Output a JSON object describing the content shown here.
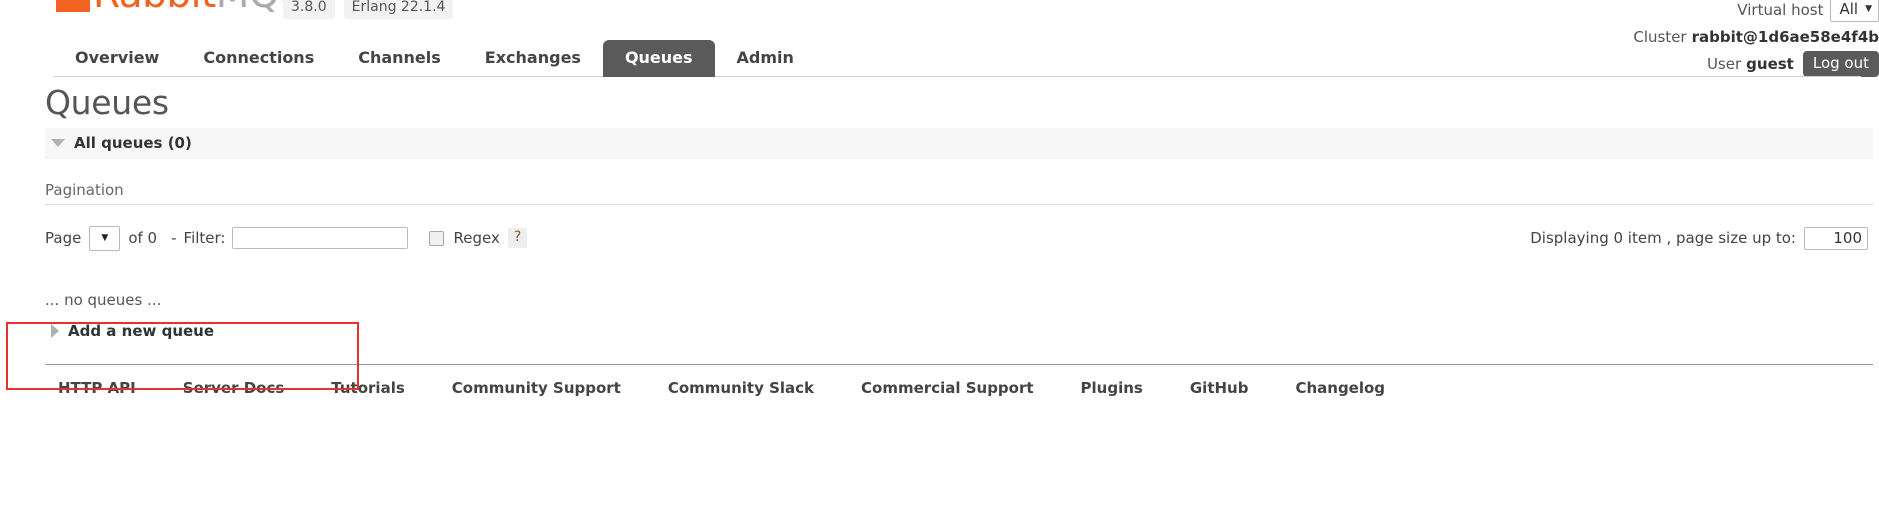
{
  "header": {
    "logo": {
      "brand_first": "Rabbit",
      "brand_second": "MQ",
      "trademark": "™"
    },
    "version_badge": "3.8.0",
    "erlang_badge": "Erlang 22.1.4",
    "virtual_host_label": "Virtual host",
    "virtual_host_value": "All",
    "cluster_label": "Cluster",
    "cluster_value": "rabbit@1d6ae58e4f4b",
    "user_label": "User",
    "user_value": "guest",
    "logout_label": "Log out"
  },
  "nav": {
    "tabs": [
      {
        "label": "Overview",
        "selected": false
      },
      {
        "label": "Connections",
        "selected": false
      },
      {
        "label": "Channels",
        "selected": false
      },
      {
        "label": "Exchanges",
        "selected": false
      },
      {
        "label": "Queues",
        "selected": true
      },
      {
        "label": "Admin",
        "selected": false
      }
    ]
  },
  "main": {
    "page_title": "Queues",
    "all_queues_label": "All queues (0)",
    "pagination": {
      "section_title": "Pagination",
      "page_label": "Page",
      "page_value": "",
      "of_label": "of 0",
      "separator": "-",
      "filter_label": "Filter:",
      "filter_value": "",
      "filter_placeholder": "",
      "regex_label": "Regex",
      "regex_checked": false,
      "help_label": "?",
      "displaying_text": "Displaying 0 item , page size up to:",
      "page_size_value": "100"
    },
    "empty_message": "... no queues ...",
    "add_queue_label": "Add a new queue"
  },
  "footer": {
    "links": [
      "HTTP API",
      "Server Docs",
      "Tutorials",
      "Community Support",
      "Community Slack",
      "Commercial Support",
      "Plugins",
      "GitHub",
      "Changelog"
    ]
  },
  "colors": {
    "brand_orange": "#f26322",
    "selected_tab": "#5a5a5a",
    "annotation_red": "#e8302f"
  }
}
